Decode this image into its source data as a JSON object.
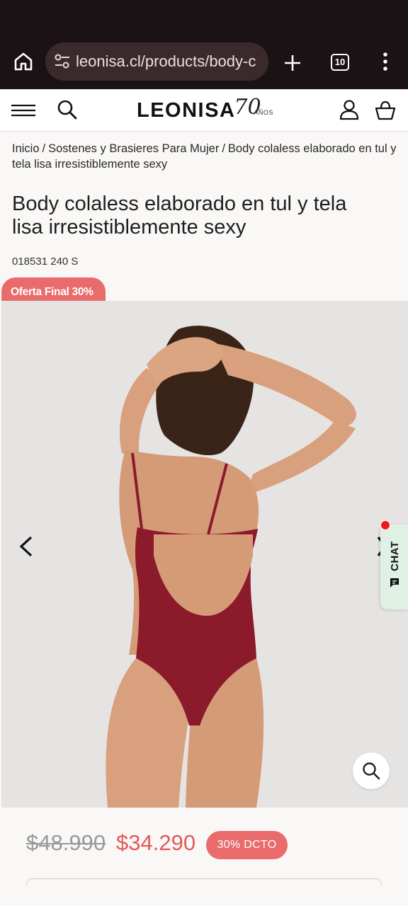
{
  "browser": {
    "url": "leonisa.cl/products/body-c",
    "tab_count": "10"
  },
  "header": {
    "brand": "LEONISA",
    "anniversary_number": "70",
    "anniversary_word": "AÑOS"
  },
  "breadcrumb": {
    "items": [
      "Inicio",
      "Sostenes y Brasieres Para Mujer",
      "Body colaless elaborado en tul y tela lisa irresistiblemente sexy"
    ],
    "separator": "/"
  },
  "product": {
    "title": "Body colaless elaborado en tul y tela lisa irresistiblemente sexy",
    "sku": "018531 240 S",
    "offer_badge": "Oferta Final 30%",
    "price_original": "$48.990",
    "price_sale": "$34.290",
    "discount_label": "30% DCTO",
    "image_color": "#8b1a2b"
  },
  "chat": {
    "label": "CHAT"
  }
}
